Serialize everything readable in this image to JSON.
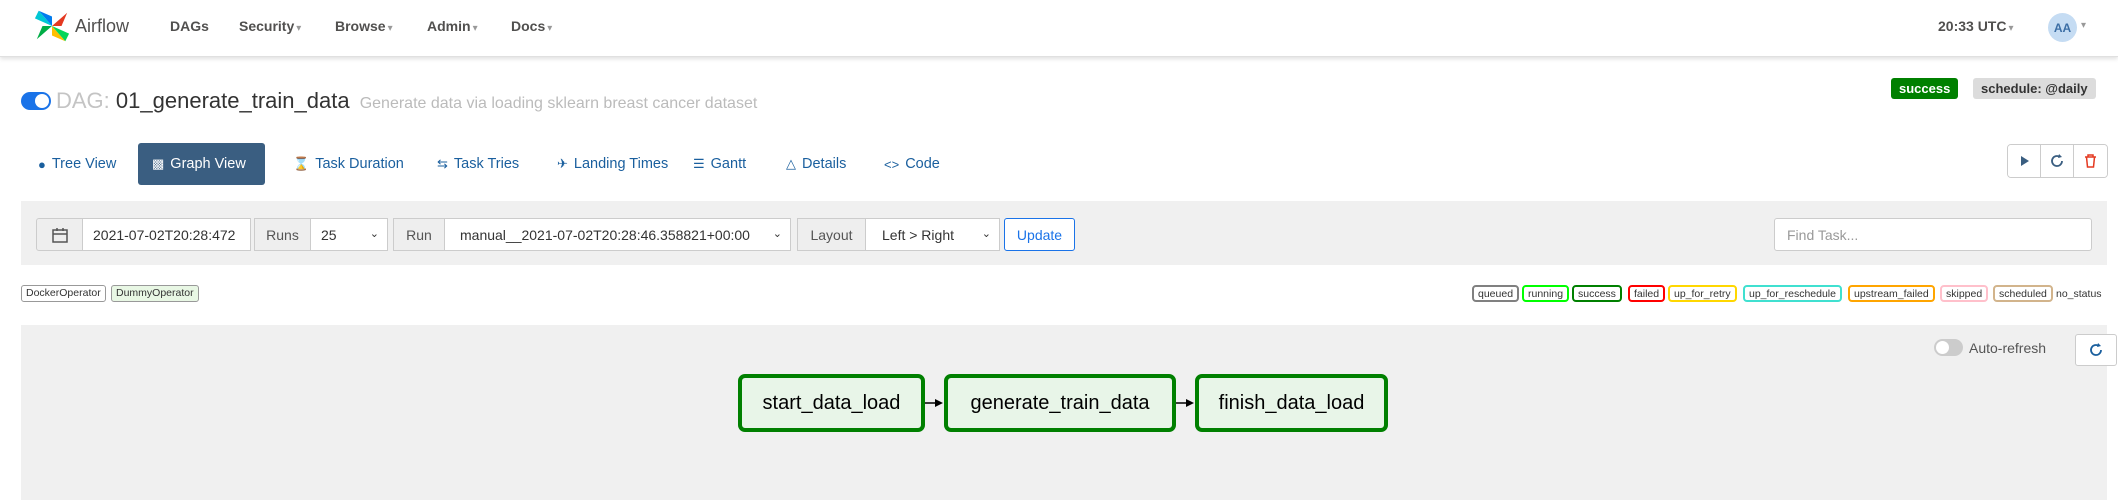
{
  "nav": {
    "brand": "Airflow",
    "items": [
      "DAGs",
      "Security",
      "Browse",
      "Admin",
      "Docs"
    ],
    "clock": "20:33 UTC",
    "avatar": "AA"
  },
  "dag": {
    "prefix": "DAG:",
    "id": "01_generate_train_data",
    "description": "Generate data via loading sklearn breast cancer dataset",
    "status_badge": "success",
    "schedule_badge": "schedule: @daily",
    "paused": false
  },
  "views": {
    "tabs": [
      {
        "label": "Tree View",
        "icon": "tree-icon"
      },
      {
        "label": "Graph View",
        "icon": "graph-icon",
        "active": true
      },
      {
        "label": "Task Duration",
        "icon": "hourglass-icon"
      },
      {
        "label": "Task Tries",
        "icon": "retry-icon"
      },
      {
        "label": "Landing Times",
        "icon": "landing-icon"
      },
      {
        "label": "Gantt",
        "icon": "gantt-icon"
      },
      {
        "label": "Details",
        "icon": "warning-triangle-icon"
      },
      {
        "label": "Code",
        "icon": "code-icon"
      }
    ],
    "actions": [
      "play-icon",
      "refresh-icon",
      "trash-icon"
    ]
  },
  "filters": {
    "base_date": "2021-07-02T20:28:472",
    "runs_label": "Runs",
    "runs_value": "25",
    "run_label": "Run",
    "run_value": "manual__2021-07-02T20:28:46.358821+00:00",
    "layout_label": "Layout",
    "layout_value": "Left > Right",
    "update_label": "Update",
    "find_placeholder": "Find Task..."
  },
  "operators": [
    {
      "label": "DockerOperator",
      "color": "#ffffff"
    },
    {
      "label": "DummyOperator",
      "color": "#e8f7e4"
    }
  ],
  "states": [
    {
      "label": "queued",
      "color": "#808080"
    },
    {
      "label": "running",
      "color": "#00ff00"
    },
    {
      "label": "success",
      "color": "#008000"
    },
    {
      "label": "failed",
      "color": "#ff0000"
    },
    {
      "label": "up_for_retry",
      "color": "#ffd700"
    },
    {
      "label": "up_for_reschedule",
      "color": "#40e0d0"
    },
    {
      "label": "upstream_failed",
      "color": "#ffa500"
    },
    {
      "label": "skipped",
      "color": "#ffc0cb"
    },
    {
      "label": "scheduled",
      "color": "#d2b48c"
    },
    {
      "label": "no_status",
      "color": null
    }
  ],
  "graph": {
    "auto_refresh_label": "Auto-refresh",
    "auto_refresh_on": false,
    "nodes": [
      "start_data_load",
      "generate_train_data",
      "finish_data_load"
    ],
    "node_state": "success"
  }
}
